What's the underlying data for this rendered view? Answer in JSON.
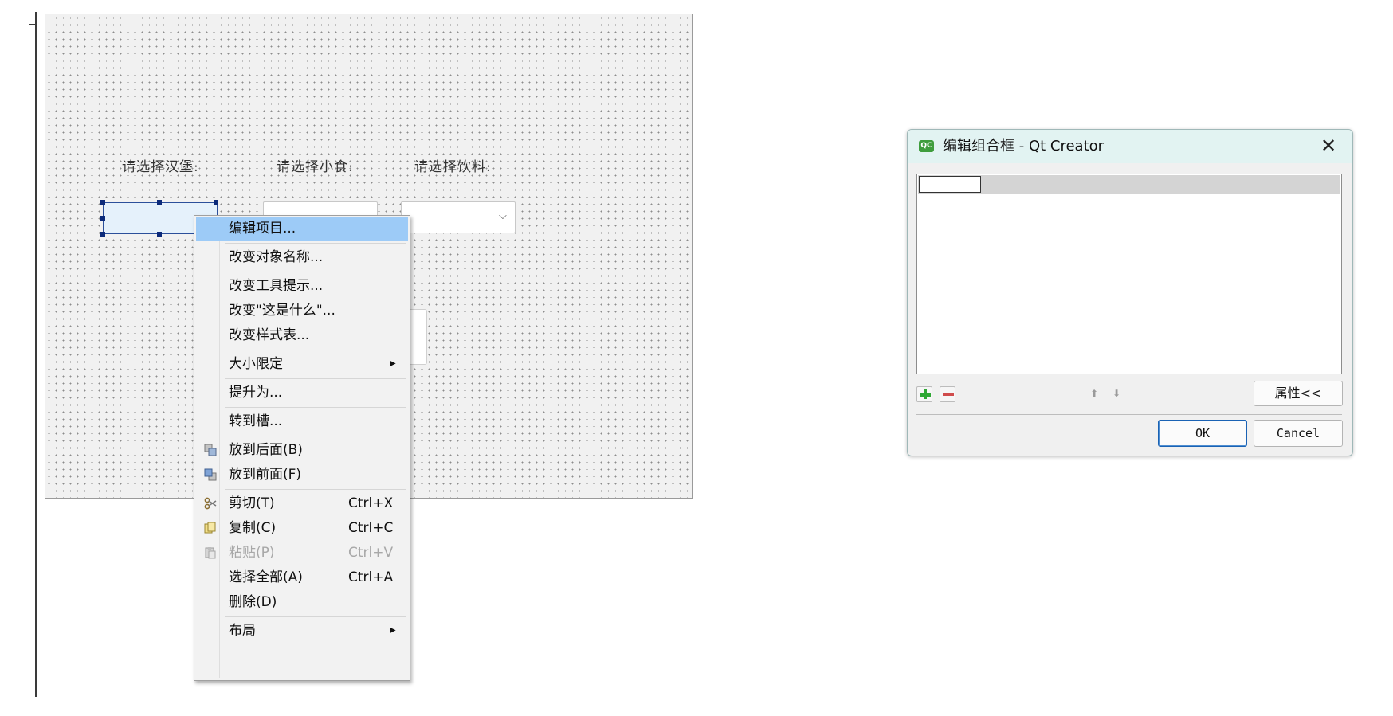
{
  "form": {
    "labels": [
      "请选择汉堡:",
      "请选择小食:",
      "请选择饮料:"
    ]
  },
  "context_menu": {
    "items": [
      {
        "label": "编辑项目...",
        "highlighted": true
      },
      {
        "label": "改变对象名称..."
      },
      {
        "label": "改变工具提示..."
      },
      {
        "label": "改变\"这是什么\"..."
      },
      {
        "label": "改变样式表..."
      },
      {
        "label": "大小限定",
        "submenu": true
      },
      {
        "label": "提升为..."
      },
      {
        "label": "转到槽..."
      },
      {
        "label": "放到后面(B)",
        "icon": "send-to-back-icon"
      },
      {
        "label": "放到前面(F)",
        "icon": "bring-to-front-icon"
      },
      {
        "label": "剪切(T)",
        "shortcut": "Ctrl+X",
        "icon": "scissors-icon"
      },
      {
        "label": "复制(C)",
        "shortcut": "Ctrl+C",
        "icon": "copy-icon"
      },
      {
        "label": "粘贴(P)",
        "shortcut": "Ctrl+V",
        "icon": "paste-icon",
        "disabled": true
      },
      {
        "label": "选择全部(A)",
        "shortcut": "Ctrl+A"
      },
      {
        "label": "删除(D)"
      },
      {
        "label": "布局",
        "submenu": true
      }
    ]
  },
  "dialog": {
    "icon_text": "QC",
    "title": "编辑组合框 - Qt Creator",
    "close_glyph": "✕",
    "properties_label": "属性<<",
    "ok_label": "OK",
    "cancel_label": "Cancel",
    "move_up_glyph": "⬆",
    "move_down_glyph": "⬇"
  },
  "icons": {
    "chevron_down": "⌵",
    "submenu_arrow": "▶"
  },
  "colors": {
    "menu_highlight": "#9dcbf7",
    "selection_handle": "#0c2a7a",
    "dialog_titlebar": "#e2f3f2",
    "add_icon": "#2fa835",
    "remove_icon": "#d04c4c"
  }
}
